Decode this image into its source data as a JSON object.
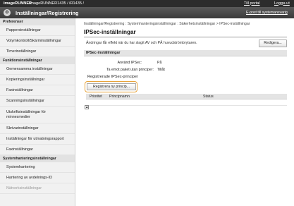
{
  "topbar": {
    "brand": "imageRUNNER",
    "model": "imageRUNNER1435 / iR1435 /",
    "portal_link": "Till portal",
    "logout_link": "Logga ut"
  },
  "titlebar": {
    "title": "Inställningar/Registrering",
    "email_link": "E-post till systemansvarig"
  },
  "sidebar": {
    "groups": [
      {
        "heading": "Preferenser",
        "items": [
          "Pappersinställningar",
          "Volymkontroll/Skärminställningar",
          "Timerinställningar"
        ]
      },
      {
        "heading": "Funktionsinställningar",
        "items": [
          "Gemensamma inställningar",
          "Kopieringsinställningar",
          "Faxinställningar",
          "Scanningsinställningar",
          "Utskriftsinställningar för minnesmedier",
          "Skrivarinställningar",
          "Inställningar för utmatningsrapport",
          "Faxinställningar"
        ]
      },
      {
        "heading": "Systemhanteringsinställningar",
        "items": [
          "Systemhantering",
          "Hantering av avdelnings-ID",
          "Nätverksinställningar"
        ]
      }
    ]
  },
  "main": {
    "breadcrumb": "Inställningar/Registrering : Systemhanteringsinställningar : Säkerhetsinställningar > IPSec-inställningar",
    "page_title": "IPSec-inställningar",
    "description": "Ändringar får effekt när du har slagit AV och PÅ huvudströmbrytaren.",
    "edit_button": "Redigera...",
    "section_head": "IPSec-inställningar",
    "use_ipsec_label": "Använd IPSec:",
    "use_ipsec_value": "På",
    "receive_label": "Ta emot paket utan principer:",
    "receive_value": "Tillåt",
    "registered_head": "Registrerade IPSec-principer",
    "register_button": "Registrera ny princip...",
    "table_headers": [
      "Prioritet",
      "Principnamn",
      "Status"
    ]
  },
  "colors": {
    "highlight": "#e7a33a",
    "topbar": "#2c2c2c",
    "titlebar": "#4a4a4a"
  }
}
